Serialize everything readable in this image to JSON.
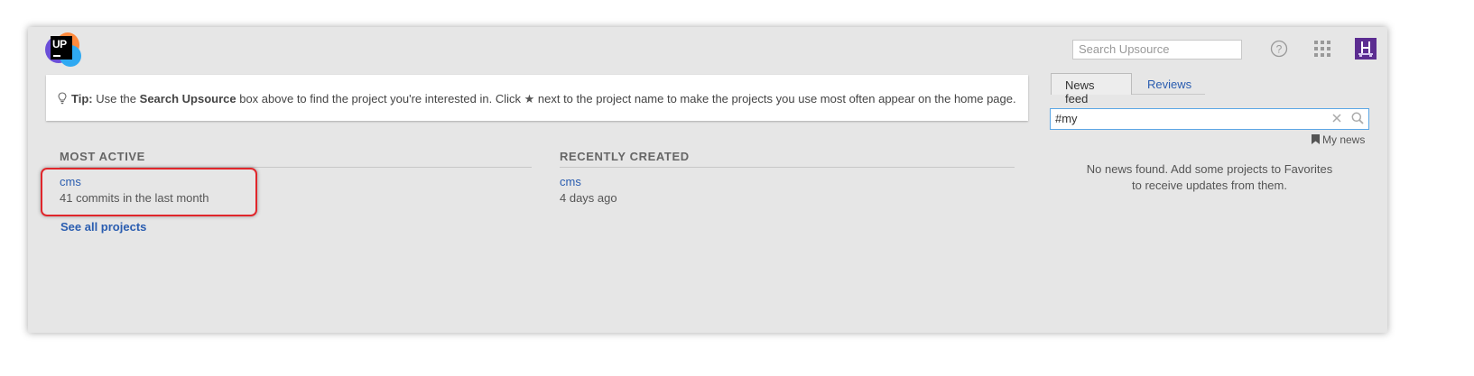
{
  "header": {
    "logo_text": "UP",
    "search_placeholder": "Search Upsource"
  },
  "tip": {
    "label": "Tip:",
    "text_before": "Use the",
    "search_name": "Search Upsource",
    "text_middle": "box above to find the project you're interested in. Click",
    "text_after": "next to the project name to make the projects you use most often appear on the home page."
  },
  "most_active": {
    "title": "MOST ACTIVE",
    "project_name": "cms",
    "project_detail": "41 commits in the last month",
    "see_all": "See all projects"
  },
  "recently_created": {
    "title": "RECENTLY CREATED",
    "project_name": "cms",
    "project_detail": "4 days ago"
  },
  "feed": {
    "tabs": [
      "News feed",
      "Reviews"
    ],
    "active_tab": "News feed",
    "filter_value": "#my",
    "my_news_label": "My news",
    "empty_line1": "No news found. Add some projects to Favorites",
    "empty_line2": "to receive updates from them."
  },
  "colors": {
    "link": "#2a5db0",
    "highlight": "#e0262b",
    "avatar": "#5c2d91"
  }
}
